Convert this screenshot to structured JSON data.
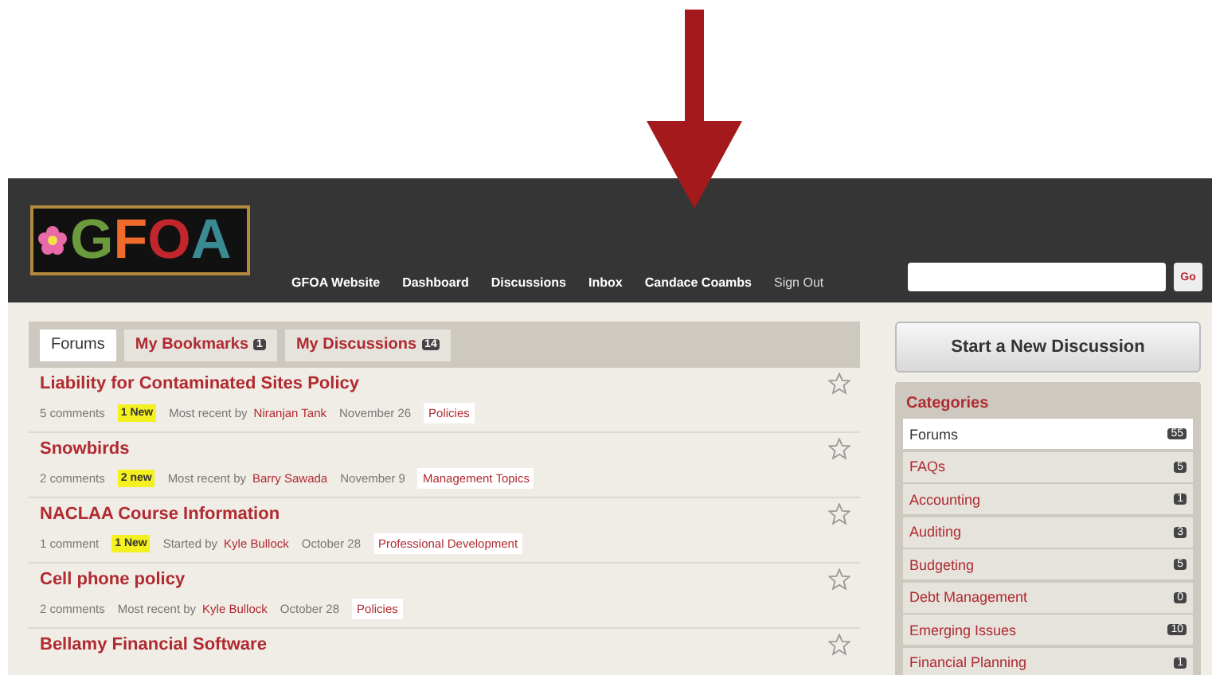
{
  "logo": {
    "letters": [
      {
        "text": "G",
        "color": "#6b9a3c"
      },
      {
        "text": "F",
        "color": "#f06a2c"
      },
      {
        "text": "O",
        "color": "#c0262c"
      },
      {
        "text": "A",
        "color": "#3a8a94"
      }
    ]
  },
  "nav": [
    "GFOA Website",
    "Dashboard",
    "Discussions",
    "Inbox",
    "Candace Coambs",
    "Sign Out"
  ],
  "search": {
    "button": "Go"
  },
  "tabs": [
    {
      "label": "Forums",
      "selected": true
    },
    {
      "label": "My Bookmarks",
      "count": "1",
      "selected": false
    },
    {
      "label": "My Discussions",
      "count": "14",
      "selected": false
    }
  ],
  "discussions": [
    {
      "title": "Liability for Contaminated Sites Policy",
      "bookmarked": false,
      "comments": "5 comments",
      "badge": "1 New",
      "activity": "Most recent by",
      "author": "Niranjan Tank",
      "date": "November 26",
      "category": "Policies"
    },
    {
      "title": "Snowbirds",
      "bookmarked": false,
      "comments": "2 comments",
      "badge": "2 new",
      "activity": "Most recent by",
      "author": "Barry Sawada",
      "date": "November 9",
      "category": "Management Topics"
    },
    {
      "title": "NACLAA Course Information",
      "bookmarked": false,
      "comments": "1 comment",
      "badge": "1 New",
      "activity": "Started by",
      "author": "Kyle Bullock",
      "date": "October 28",
      "category": "Professional Development"
    },
    {
      "title": "Cell phone policy",
      "bookmarked": false,
      "comments": "2 comments",
      "activity": "Most recent by",
      "author": "Kyle Bullock",
      "date": "October 28",
      "category": "Policies"
    },
    {
      "title": "Bellamy Financial Software",
      "bookmarked": false
    }
  ],
  "new_discussion_button": "Start a New Discussion",
  "categories": {
    "title": "Categories",
    "items": [
      {
        "label": "Forums",
        "count": "55",
        "selected": true
      },
      {
        "label": "FAQs",
        "count": "5",
        "selected": false
      },
      {
        "label": "Accounting",
        "count": "1",
        "selected": false
      },
      {
        "label": "Auditing",
        "count": "3",
        "selected": false
      },
      {
        "label": "Budgeting",
        "count": "5",
        "selected": false
      },
      {
        "label": "Debt Management",
        "count": "0",
        "selected": false
      },
      {
        "label": "Emerging Issues",
        "count": "10",
        "selected": false
      },
      {
        "label": "Financial Planning",
        "count": "1",
        "selected": false
      }
    ]
  }
}
